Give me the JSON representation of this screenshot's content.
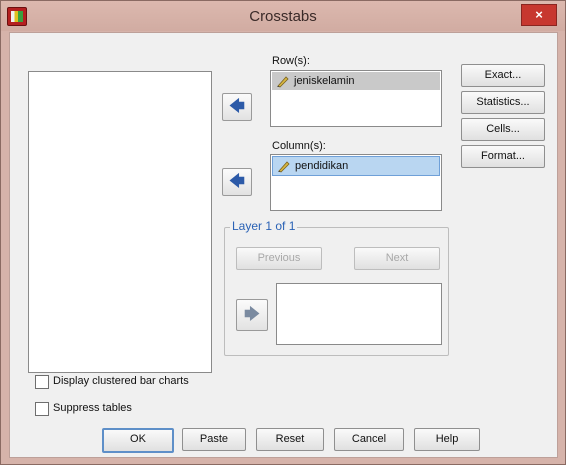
{
  "window": {
    "title": "Crosstabs",
    "close_glyph": "×"
  },
  "rows": {
    "label": "Row(s):",
    "items": [
      "jeniskelamin"
    ]
  },
  "columns": {
    "label": "Column(s):",
    "items": [
      "pendidikan"
    ]
  },
  "layer": {
    "title": "Layer 1 of 1",
    "previous": "Previous",
    "next": "Next"
  },
  "side_buttons": {
    "exact": "Exact...",
    "statistics": "Statistics...",
    "cells": "Cells...",
    "format": "Format..."
  },
  "options": {
    "clustered_bar_charts": "Display clustered bar charts",
    "suppress_tables": "Suppress tables"
  },
  "footer": {
    "ok": "OK",
    "paste": "Paste",
    "reset": "Reset",
    "cancel": "Cancel",
    "help": "Help"
  },
  "icons": {
    "arrow_left": "🡄",
    "arrow_right": "🡆",
    "variable": "pencil-ruler-icon"
  }
}
